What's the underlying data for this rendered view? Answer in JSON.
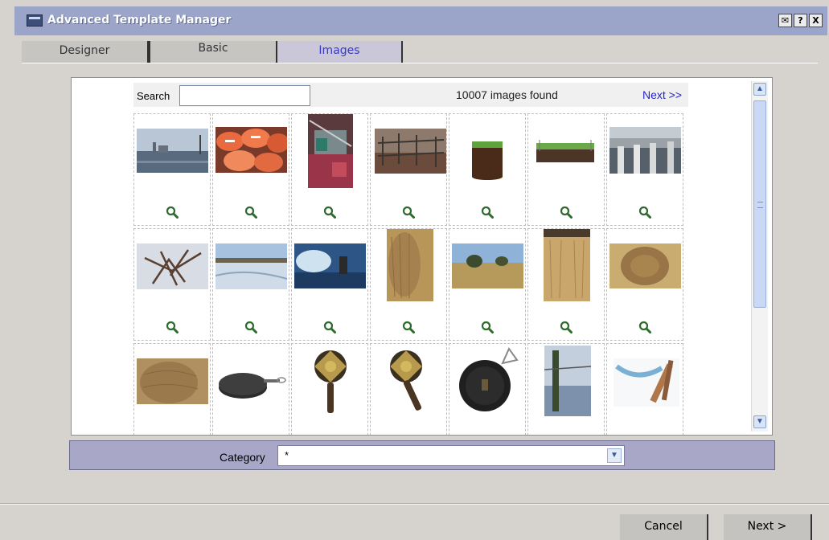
{
  "window": {
    "title": "Advanced Template Manager",
    "controls": [
      "mail-icon",
      "help-icon",
      "close-icon"
    ],
    "control_glyphs": [
      "✉",
      "?",
      "X"
    ]
  },
  "tabs": [
    {
      "label": "Designer",
      "active": false
    },
    {
      "label": "Basic",
      "active": false
    },
    {
      "label": "Images",
      "active": true
    }
  ],
  "search": {
    "label": "Search",
    "value": "",
    "found_text": "10007 images found",
    "next_link": "Next >>"
  },
  "images": {
    "rows": [
      [
        "lake-with-city-skyline",
        "orange-buoys",
        "red-fishing-boats",
        "construction-framework",
        "soil-sample-green-top",
        "soil-cross-section",
        "dock-pilings"
      ],
      [
        "branches-in-snow",
        "snowy-field",
        "water-splash-scene",
        "hay-bale-closeup",
        "field-with-trees",
        "wheat-field",
        "round-hay-bale"
      ],
      [
        "hay-bale-field",
        "cast-iron-pan-lid",
        "brass-compass-dish",
        "brass-compass-dish-2",
        "black-frying-pan",
        "snowy-fence-post",
        "blue-ribbon-pole"
      ]
    ],
    "zoom_icon": "magnifier-zoom-icon"
  },
  "category": {
    "label": "Category",
    "value": "*"
  },
  "buttons": {
    "cancel": "Cancel",
    "next": "Next >"
  },
  "colors": {
    "titlebar": "#9aa5c9",
    "tab_active_text": "#3a3ac0",
    "link": "#2424c8",
    "category_bar": "#a9a7c7"
  }
}
